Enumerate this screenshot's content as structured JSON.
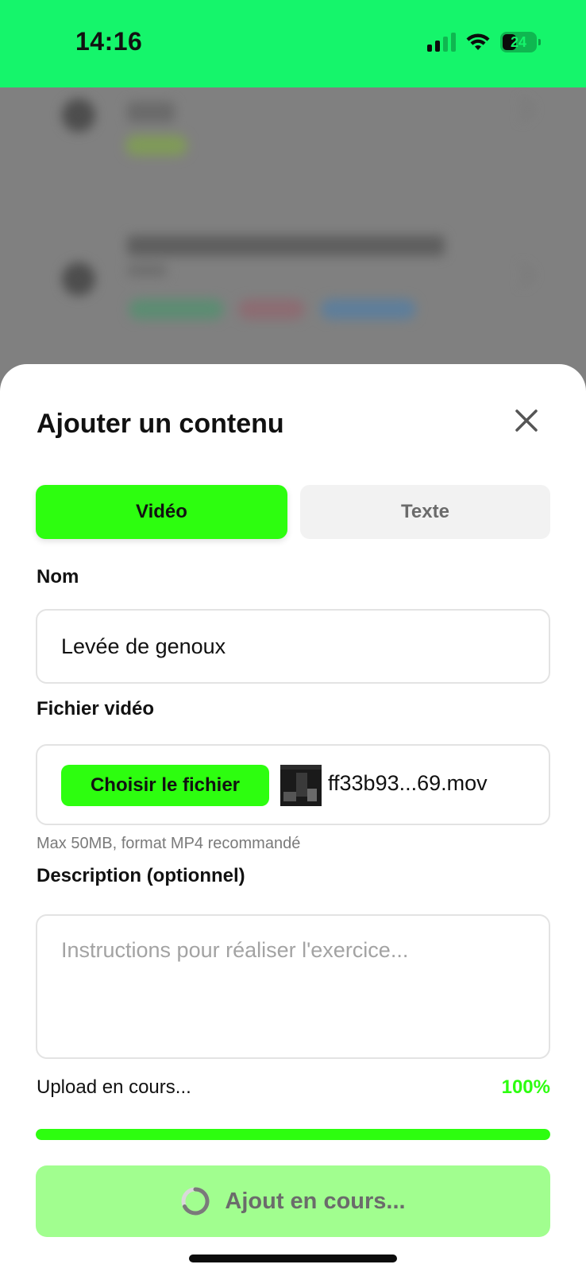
{
  "status_bar": {
    "time": "14:16",
    "battery": "24",
    "background_color": "#15f56b"
  },
  "sheet": {
    "title": "Ajouter un contenu",
    "close_icon": "close-icon"
  },
  "segments": {
    "video_label": "Vidéo",
    "text_label": "Texte",
    "selected": "video"
  },
  "form": {
    "name_label": "Nom",
    "name_value": "Levée de genoux",
    "file_label": "Fichier vidéo",
    "choose_button": "Choisir le fichier",
    "file_name": "ff33b93...69.mov",
    "file_hint": "Max 50MB, format MP4 recommandé",
    "description_label": "Description (optionnel)",
    "description_placeholder": "Instructions pour réaliser l'exercice...",
    "description_value": ""
  },
  "upload": {
    "label": "Upload en cours...",
    "percent_text": "100%",
    "progress": 1.0,
    "accent_color": "#2dfe0f"
  },
  "submit": {
    "label": "Ajout en cours...",
    "background_color": "#a1fe8f",
    "icon": "spinner-icon"
  }
}
